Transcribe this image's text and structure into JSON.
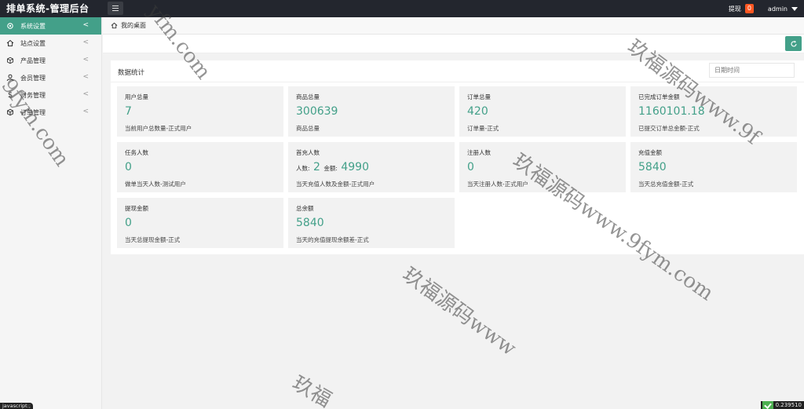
{
  "app": {
    "title": "排单系统-管理后台",
    "withdraw_label": "提现",
    "withdraw_count": "0",
    "user_name": "admin"
  },
  "sidebar": {
    "items": [
      {
        "label": "系统设置",
        "icon": "gear-icon"
      },
      {
        "label": "站点设置",
        "icon": "home-icon"
      },
      {
        "label": "产品管理",
        "icon": "box-icon"
      },
      {
        "label": "会员管理",
        "icon": "user-icon"
      },
      {
        "label": "财务管理",
        "icon": "dollar-icon"
      },
      {
        "label": "订单管理",
        "icon": "cube-icon"
      }
    ]
  },
  "breadcrumb": {
    "home_label": "我的桌面"
  },
  "panel": {
    "title": "数据统计",
    "date_placeholder": "日期时间"
  },
  "stats": [
    {
      "label": "用户总量",
      "value": "7",
      "note": "当前用户总数量-正式用户"
    },
    {
      "label": "商品总量",
      "value": "300639",
      "note": "商品总量"
    },
    {
      "label": "订单总量",
      "value": "420",
      "note": "订单量-正式"
    },
    {
      "label": "已完成订单金额",
      "value": "1160101.18",
      "note": "已提交订单总金额-正式"
    },
    {
      "label": "任务人数",
      "value": "0",
      "note": "做单当天人数-测试用户"
    },
    {
      "label": "首充人数",
      "people_label": "人数:",
      "people_value": "2",
      "amount_label": "金额:",
      "amount_value": "4990",
      "note": "当天充值人数及金额-正式用户"
    },
    {
      "label": "注册人数",
      "value": "0",
      "note": "当天注册人数-正式用户"
    },
    {
      "label": "充值金额",
      "value": "5840",
      "note": "当天总充值金额-正式"
    },
    {
      "label": "提现金额",
      "value": "0",
      "note": "当天总提现金额-正式"
    },
    {
      "label": "总余额",
      "value": "5840",
      "note": "当天的充值提现余额差-正式"
    }
  ],
  "watermarks": {
    "w1": "yfm.com",
    "w2": "9fym.com",
    "w3": "玖福源码www.9f",
    "w4": "玖福源码www.9fym.com",
    "w5": "玖福源码www",
    "w6": "玖福"
  },
  "status": {
    "js_label": "javascript:;",
    "perf_value": "0.239510"
  },
  "colors": {
    "accent": "#43a089",
    "topbar": "#23262e",
    "badge": "#ff5722"
  }
}
